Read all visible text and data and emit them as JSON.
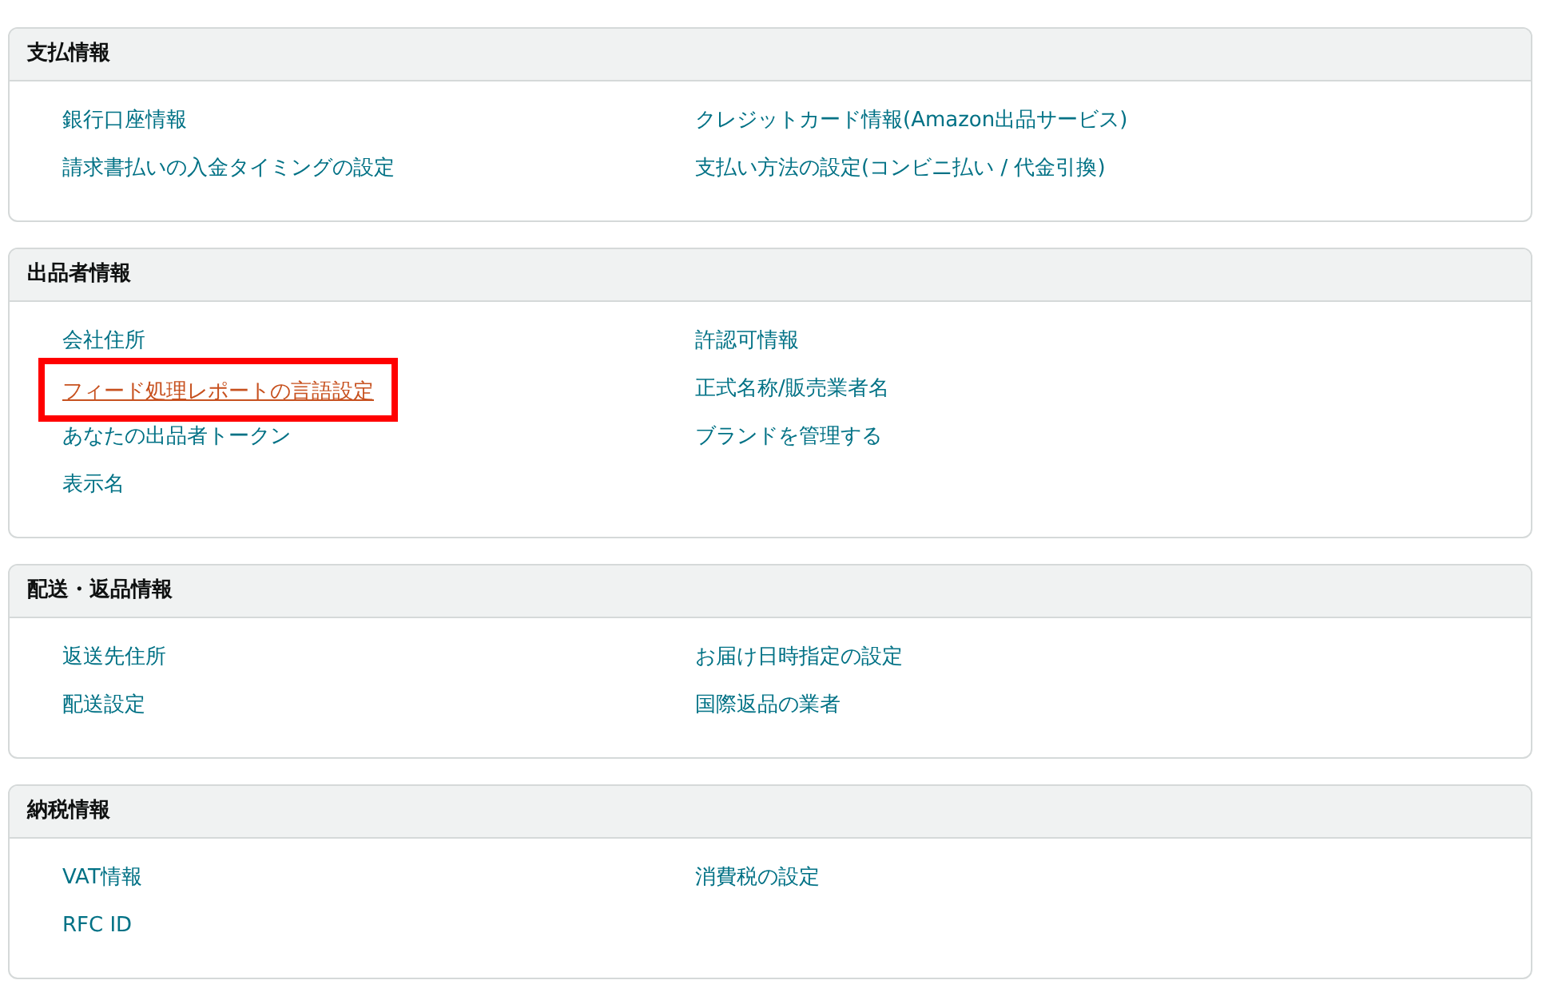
{
  "sections": [
    {
      "title": "支払情報",
      "columns": [
        [
          {
            "label": "銀行口座情報",
            "highlighted": false
          },
          {
            "label": "請求書払いの入金タイミングの設定",
            "highlighted": false
          }
        ],
        [
          {
            "label": "クレジットカード情報(Amazon出品サービス)",
            "highlighted": false
          },
          {
            "label": "支払い方法の設定(コンビニ払い / 代金引換)",
            "highlighted": false
          }
        ]
      ]
    },
    {
      "title": "出品者情報",
      "columns": [
        [
          {
            "label": "会社住所",
            "highlighted": false
          },
          {
            "label": "フィード処理レポートの言語設定",
            "highlighted": true
          },
          {
            "label": "あなたの出品者トークン",
            "highlighted": false
          },
          {
            "label": "表示名",
            "highlighted": false
          }
        ],
        [
          {
            "label": "許認可情報",
            "highlighted": false
          },
          {
            "label": "正式名称/販売業者名",
            "highlighted": false
          },
          {
            "label": "ブランドを管理する",
            "highlighted": false
          }
        ]
      ]
    },
    {
      "title": "配送・返品情報",
      "columns": [
        [
          {
            "label": "返送先住所",
            "highlighted": false
          },
          {
            "label": "配送設定",
            "highlighted": false
          }
        ],
        [
          {
            "label": "お届け日時指定の設定",
            "highlighted": false
          },
          {
            "label": "国際返品の業者",
            "highlighted": false
          }
        ]
      ]
    },
    {
      "title": "納税情報",
      "columns": [
        [
          {
            "label": "VAT情報",
            "highlighted": false
          },
          {
            "label": "RFC ID",
            "highlighted": false
          }
        ],
        [
          {
            "label": "消費税の設定",
            "highlighted": false
          }
        ]
      ]
    }
  ]
}
